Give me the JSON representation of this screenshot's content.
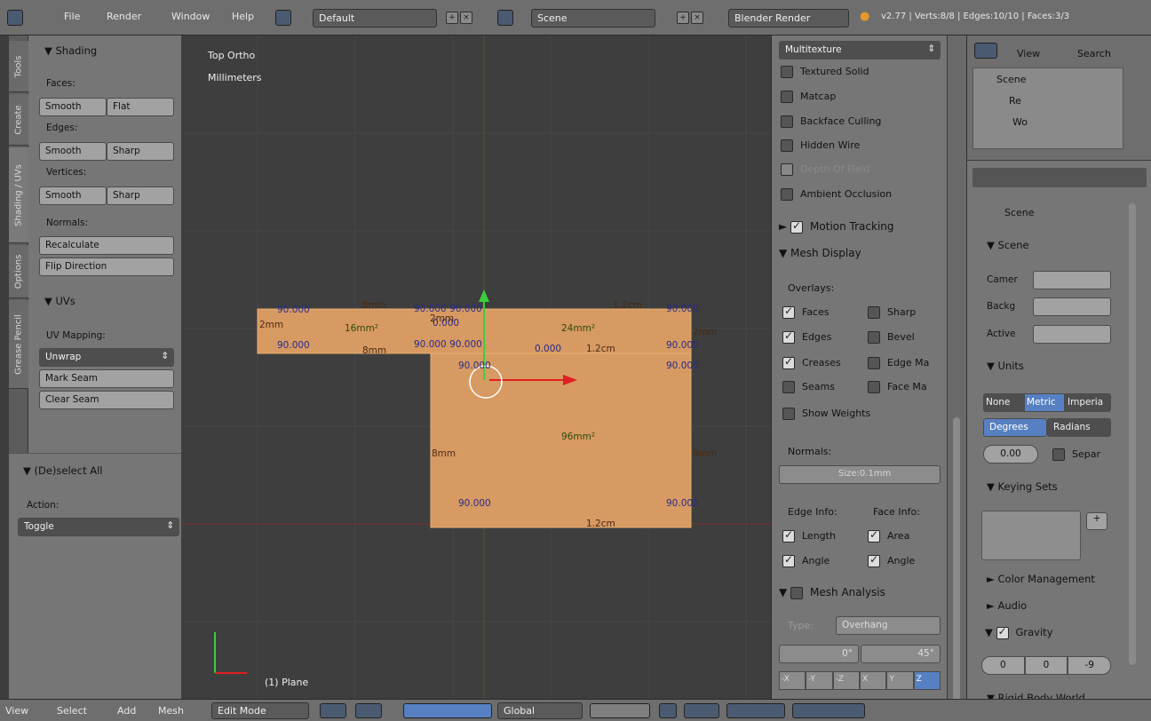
{
  "topbar": {
    "menus": [
      "File",
      "Render",
      "Window",
      "Help"
    ],
    "layout": "Default",
    "scene": "Scene",
    "engine": "Blender Render",
    "stats": "v2.77 | Verts:8/8 | Edges:10/10 | Faces:3/3"
  },
  "toolshelf": {
    "tabs": [
      "Tools",
      "Create",
      "Shading / UVs",
      "Options",
      "Grease Pencil"
    ],
    "shading_header": "▼ Shading",
    "faces_label": "Faces:",
    "edges_label": "Edges:",
    "vertices_label": "Vertices:",
    "smooth": "Smooth",
    "flat": "Flat",
    "sharp": "Sharp",
    "normals_label": "Normals:",
    "recalculate": "Recalculate",
    "flip_direction": "Flip Direction",
    "uvs_header": "▼ UVs",
    "uv_mapping": "UV Mapping:",
    "unwrap": "Unwrap",
    "mark_seam": "Mark Seam",
    "clear_seam": "Clear Seam"
  },
  "operator": {
    "header": "▼ (De)select All",
    "action_label": "Action:",
    "action_value": "Toggle"
  },
  "viewport": {
    "view_name": "Top Ortho",
    "units": "Millimeters",
    "object": "(1) Plane",
    "labels": {
      "a1": "90.000",
      "a2": "8mm",
      "a3": "90.000 90.000",
      "a4": "1.2cm",
      "a5": "90.000",
      "b1": "2mm",
      "b2": "16mm²",
      "b3": "0.000",
      "b4": "24mm²",
      "b5": "2mm",
      "c1": "90.000",
      "c2": "8mm",
      "c3": "90.000 90.000",
      "c4": "0.000",
      "c5": "1.2cm",
      "c6": "90.000",
      "d1": "90.000",
      "d2": "90.000",
      "e1": "8mm",
      "e2": "96mm²",
      "e3": "8mm",
      "f1": "90.000",
      "f2": "90.000",
      "f3": "1.2cm",
      "g1": "2mm"
    }
  },
  "nprop": {
    "shade_select": "Multitexture",
    "textured_solid": "Textured Solid",
    "matcap": "Matcap",
    "backface": "Backface Culling",
    "hidden_wire": "Hidden Wire",
    "depth_of_field": "Depth Of Field",
    "ambient": "Ambient Occlusion",
    "motion_tracking": "Motion Tracking",
    "mesh_display": "▼ Mesh Display",
    "overlays": "Overlays:",
    "faces": "Faces",
    "sharp": "Sharp",
    "edges": "Edges",
    "bevel": "Bevel",
    "creases": "Creases",
    "edge_ma": "Edge Ma",
    "seams": "Seams",
    "face_ma": "Face Ma",
    "show_weights": "Show Weights",
    "normals": "Normals:",
    "normal_size": "Size:0.1mm",
    "edge_info": "Edge Info:",
    "face_info": "Face Info:",
    "length": "Length",
    "area": "Area",
    "angle": "Angle",
    "mesh_analysis": "Mesh Analysis",
    "type_label": "Type:",
    "type_value": "Overhang",
    "angle_a": "0°",
    "angle_b": "45°",
    "axis": [
      "-X",
      "-Y",
      "-Z",
      "X",
      "Y",
      "Z"
    ]
  },
  "outliner": {
    "view": "View",
    "search": "Search",
    "items": [
      "Scene",
      "Re",
      "Wo"
    ]
  },
  "props": {
    "scene_tab": "Scene",
    "scene_header": "▼ Scene",
    "camera": "Camer",
    "background": "Backg",
    "active": "Active",
    "units_header": "▼ Units",
    "none": "None",
    "metric": "Metric",
    "imperial": "Imperia",
    "degrees": "Degrees",
    "radians": "Radians",
    "scale": "0.00",
    "separate": "Separ",
    "keying": "▼ Keying Sets",
    "color_mgmt": "► Color Management",
    "audio": "► Audio",
    "gravity": "Gravity",
    "gx": "0",
    "gy": "0",
    "gz": "-9",
    "rigid": "▼ Rigid Body World"
  },
  "bottombar": {
    "menus": [
      "View",
      "Select",
      "Add",
      "Mesh"
    ],
    "mode": "Edit Mode",
    "orientation": "Global"
  },
  "colors": {
    "mesh_face": "#d79a62",
    "accent": "#5680c2",
    "header": "#6e6e6e"
  }
}
